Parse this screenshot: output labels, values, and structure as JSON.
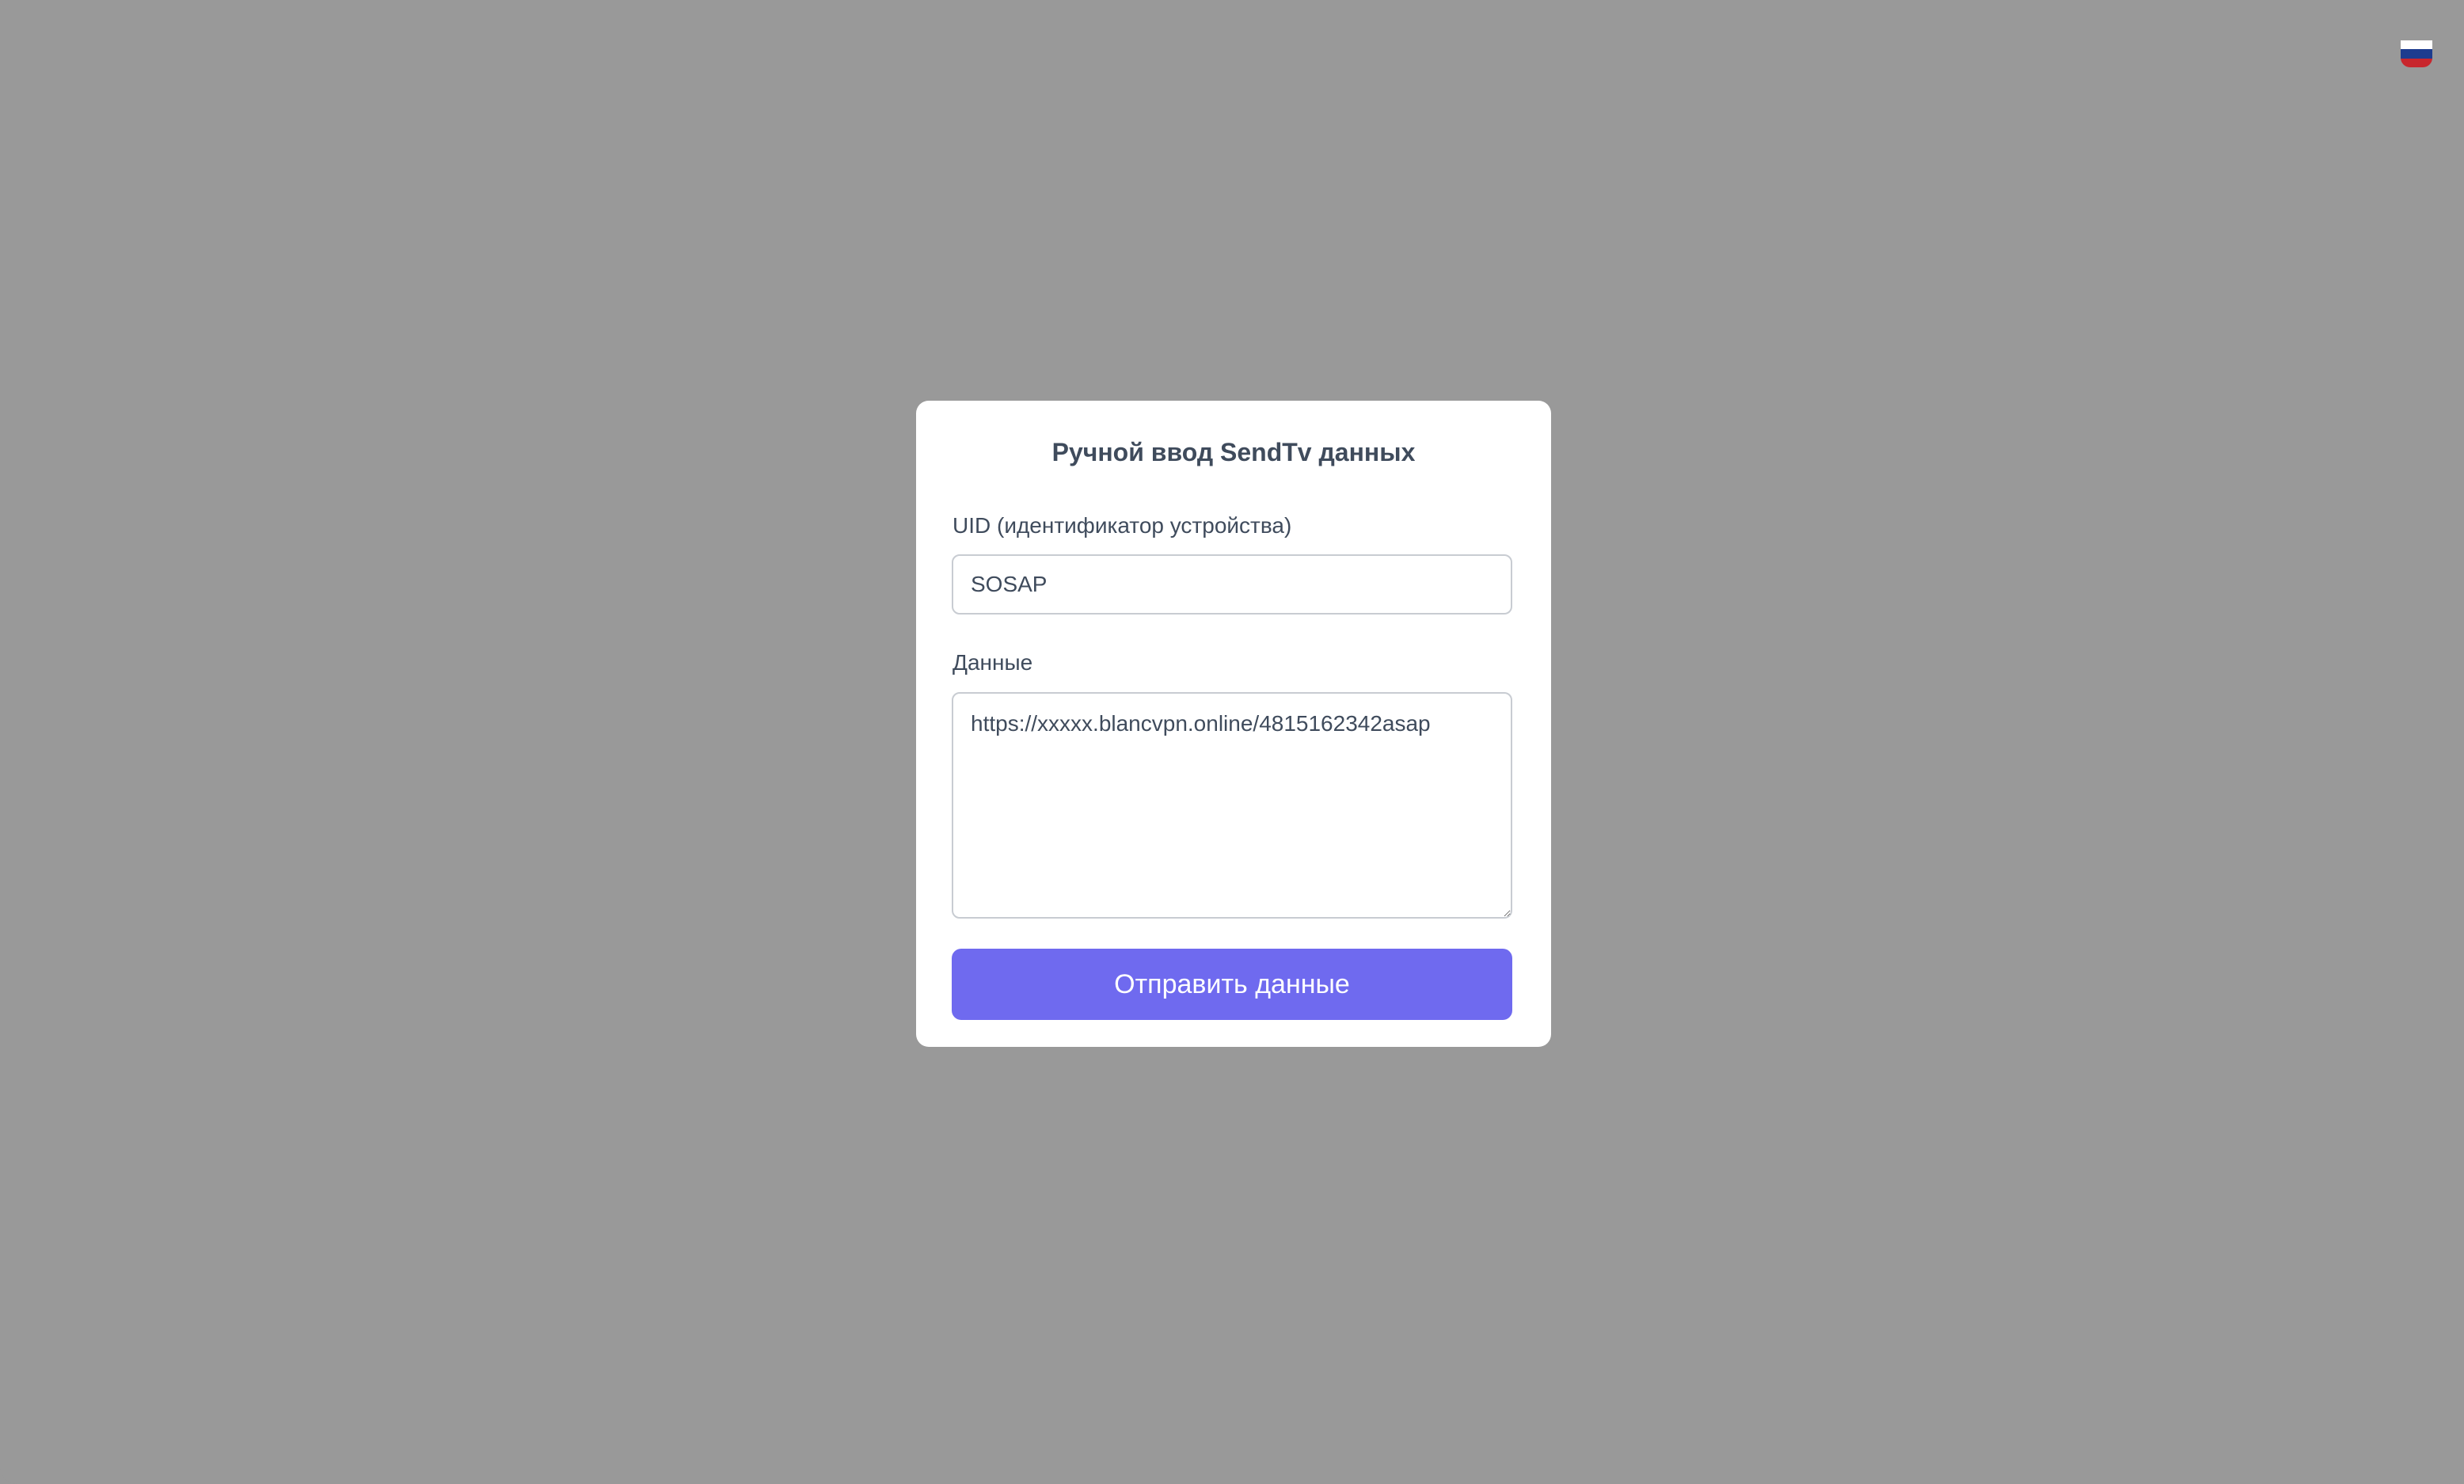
{
  "page": {
    "background_color": "#999999"
  },
  "language_selector": {
    "icon": "russian-flag-icon",
    "flag_colors": [
      "#ffffff",
      "#1d3c8f",
      "#c8262d"
    ]
  },
  "form": {
    "title": "Ручной ввод SendTv данных",
    "uid": {
      "label": "UID (идентификатор устройства)",
      "value": "SOSAP"
    },
    "data": {
      "label": "Данные",
      "value": "https://xxxxx.blancvpn.online/4815162342asap"
    },
    "submit_label": "Отправить данные",
    "accent_color": "#6f6aef"
  }
}
